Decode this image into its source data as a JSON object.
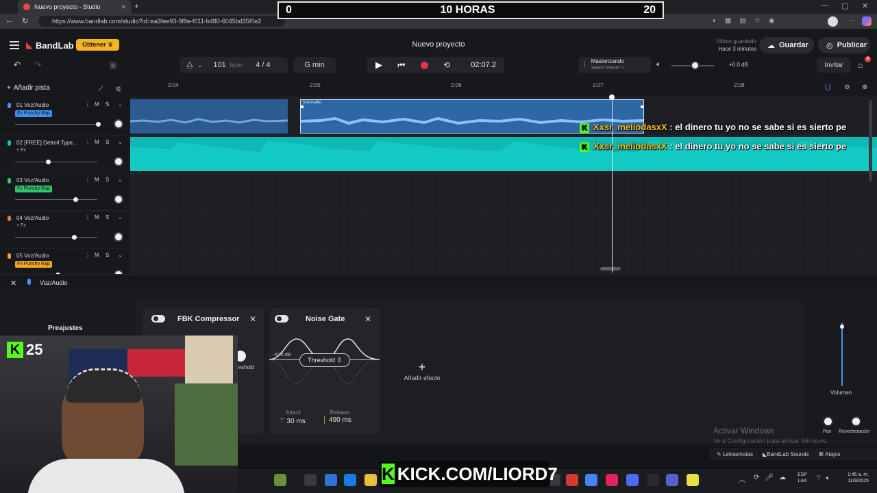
{
  "browser": {
    "tab_title": "Nuevo proyecto - Studio",
    "url": "https://www.bandlab.com/studio?id=ea3fee93-9f8e-f011-b480-6045bd35f0e2"
  },
  "overlay": {
    "left": "0",
    "center": "10 HORAS",
    "right": "20"
  },
  "header": {
    "brand": "BandLab",
    "obtener_label": "Obtener",
    "project_title": "Nuevo proyecto",
    "saved_line1": "Último guardado",
    "saved_line2": "Hace 3 minutos",
    "save_label": "Guardar",
    "publish_label": "Publicar",
    "invite_label": "Invitar",
    "notif_count": "4"
  },
  "transport": {
    "bpm": "101",
    "bpm_unit": "bpm",
    "time_sig": "4 / 4",
    "key": "G min",
    "time": "02:07.2",
    "mastering_title": "Masterizando",
    "mastering_sub": "Select Preset >",
    "master_db": "+0.0 dB",
    "master_volume": 0.55
  },
  "tracks_toolbar": {
    "add_track": "Añadir pista"
  },
  "ruler": {
    "labels": [
      "2:04",
      "2:05",
      "2:06",
      "2:07",
      "2:08"
    ]
  },
  "tracks": [
    {
      "name": "01  Voz/Audio",
      "fx": "Fx Punchy Rap",
      "fx_color": "#3f8ef5",
      "mic_color": "#4f8ff5",
      "volume": 1.0
    },
    {
      "name": "02  [FREE] Detroit Type...",
      "fx": "+ Fx",
      "fx_color": "",
      "mic_color": "#12c0bb",
      "volume": 0.38
    },
    {
      "name": "03  Voz/Audio",
      "fx": "Fx Punchy Rap",
      "fx_color": "#35c46a",
      "mic_color": "#35c46a",
      "volume": 0.72
    },
    {
      "name": "04  Voz/Audio",
      "fx": "+ Fx",
      "fx_color": "",
      "mic_color": "#e07a3a",
      "volume": 0.7
    },
    {
      "name": "05  Voz/Audio",
      "fx": "Fx Punchy Rap",
      "fx_color": "#f5a623",
      "mic_color": "#f5a623",
      "volume": 0.5
    }
  ],
  "clips": {
    "clip_label": "Voz/Audio"
  },
  "chat": [
    {
      "user": "Xxsr_meliodasxX",
      "message": ": el dinero tu yo no se sabe si es sierto pe"
    },
    {
      "user": "Xxsr_meliodasxX",
      "message": ": el dinero tu yo no se sabe si es sierto pe"
    }
  ],
  "fx_panel": {
    "track_name": "Voz/Audio",
    "presets_label": "Preajustes",
    "compressor_title": "FBK Compressor",
    "compressor_partial_label": "reshold",
    "gate_title": "Noise Gate",
    "gate_db": "-40.6 dB",
    "gate_param": "Threshold",
    "attack_label": "Attack",
    "attack_value": "30 ms",
    "release_label": "Release",
    "release_value": "490 ms",
    "add_effect": "Añadir efecto",
    "volume_label": "Volumen",
    "pan_label": "Pan",
    "reverb_label": "Reverberación",
    "volume_level": 0.95
  },
  "watermark": {
    "line1": "Activar Windows",
    "line2": "Ve a Configuración para activar Windows."
  },
  "footer": {
    "lyrics": "Letras/notas",
    "sounds": "BandLab Sounds",
    "shortcuts": "Atajos"
  },
  "webcam": {
    "kick_count": "25"
  },
  "kick_banner": {
    "k": "K",
    "text": "KICK.COM/LIORD7"
  },
  "taskbar": {
    "lang1": "ESP",
    "lang2": "LAA",
    "clock": "1:45 a. m.",
    "date": "11/9/2025"
  },
  "colors": {
    "accent": "#f0423c",
    "obtener": "#f5b324",
    "clip_blue": "#2e67a6",
    "clip_teal": "#0fb8b4",
    "kick_green": "#53fc18"
  }
}
